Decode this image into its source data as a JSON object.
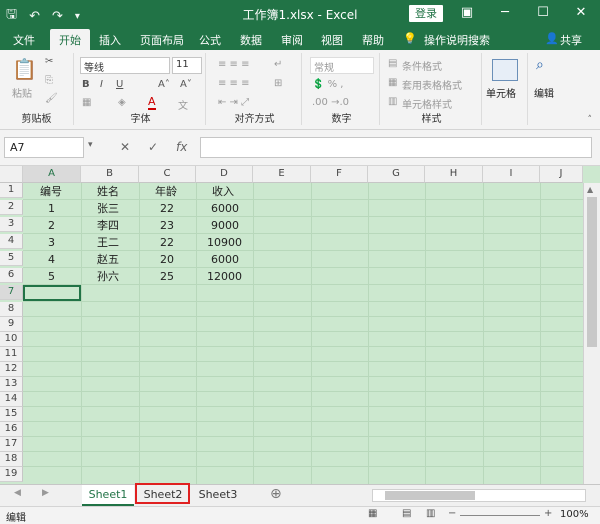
{
  "titlebar": {
    "title": "工作簿1.xlsx  -  Excel",
    "login": "登录"
  },
  "tabs": [
    "文件",
    "开始",
    "插入",
    "页面布局",
    "公式",
    "数据",
    "审阅",
    "视图",
    "帮助"
  ],
  "tell_me": "操作说明搜索",
  "share": "共享",
  "ribbon": {
    "paste": "粘贴",
    "clipboard": "剪贴板",
    "font_name": "等线",
    "font_size": "11",
    "font_group": "字体",
    "align_group": "对齐方式",
    "number_format": "常规",
    "number_group": "数字",
    "cond_format": "条件格式",
    "table_format": "套用表格格式",
    "cell_style": "单元格样式",
    "styles_group": "样式",
    "cells": "单元格",
    "editing": "编辑"
  },
  "formula": {
    "namebox": "A7",
    "fx": "fx"
  },
  "columns": [
    "A",
    "B",
    "C",
    "D",
    "E",
    "F",
    "G",
    "H",
    "I",
    "J"
  ],
  "rows": [
    "1",
    "2",
    "3",
    "4",
    "5",
    "6",
    "7",
    "8",
    "9",
    "10",
    "11",
    "12",
    "13",
    "14",
    "15",
    "16",
    "17",
    "18",
    "19"
  ],
  "table": [
    [
      "编号",
      "姓名",
      "年龄",
      "收入"
    ],
    [
      "1",
      "张三",
      "22",
      "6000"
    ],
    [
      "2",
      "李四",
      "23",
      "9000"
    ],
    [
      "3",
      "王二",
      "22",
      "10900"
    ],
    [
      "4",
      "赵五",
      "20",
      "6000"
    ],
    [
      "5",
      "孙六",
      "25",
      "12000"
    ]
  ],
  "sheets": [
    "Sheet1",
    "Sheet2",
    "Sheet3"
  ],
  "status": {
    "mode": "编辑",
    "zoom": "100%"
  }
}
